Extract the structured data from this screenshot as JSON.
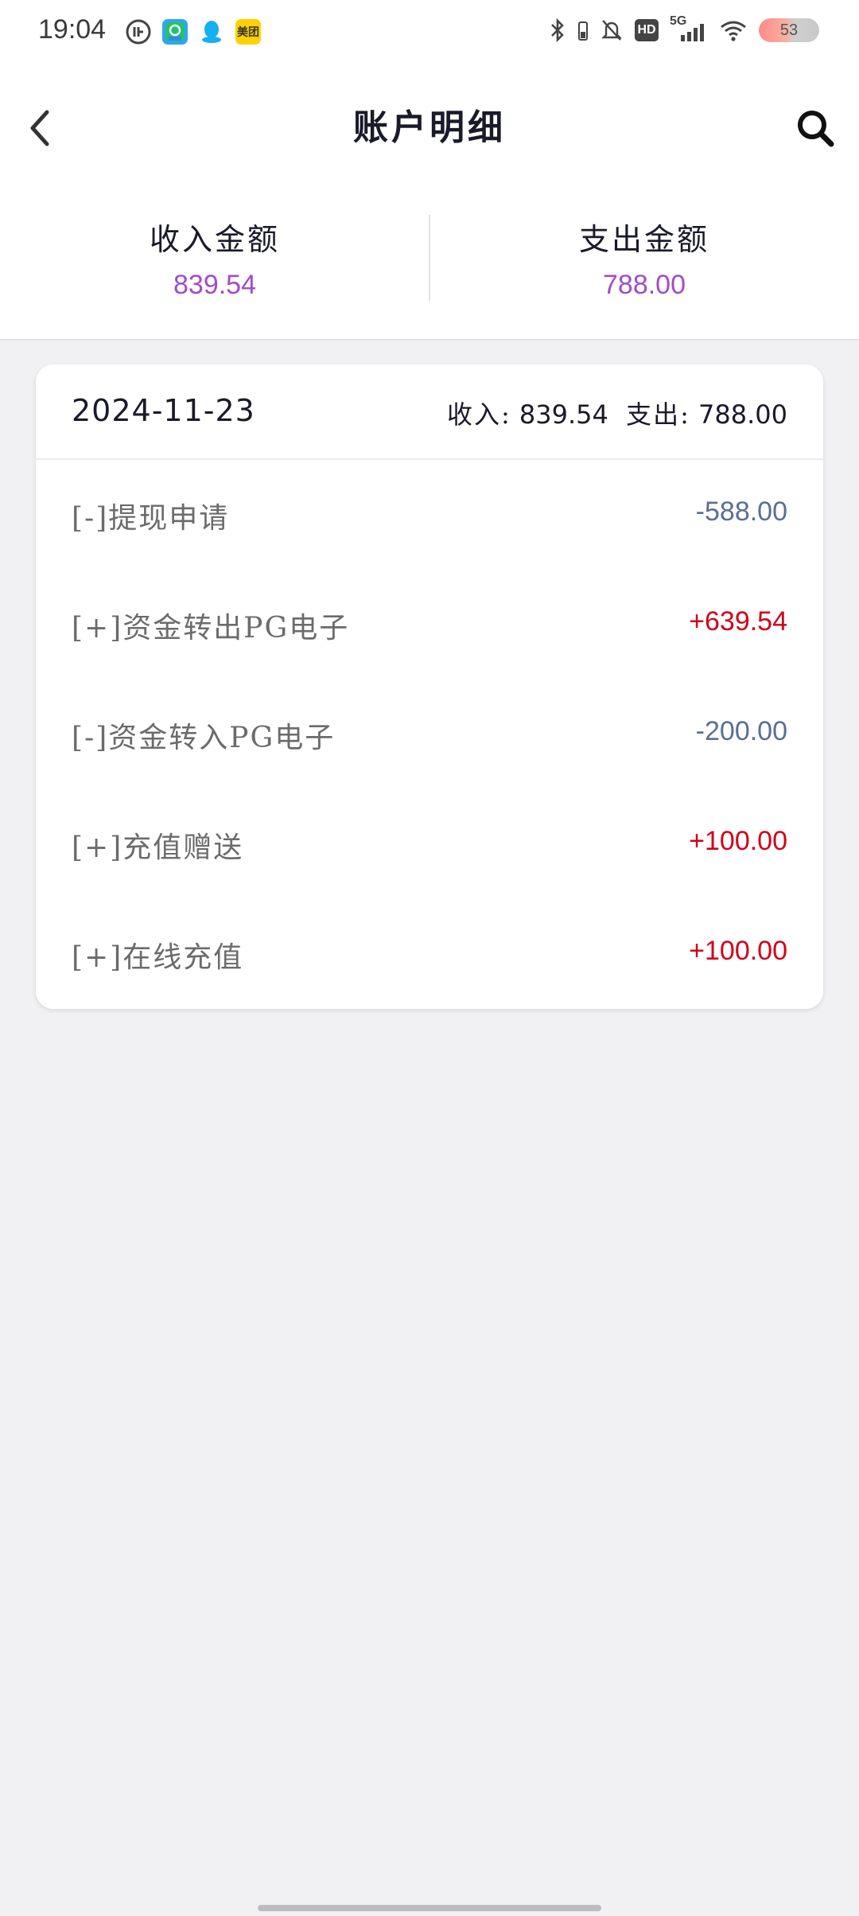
{
  "status_bar": {
    "time": "19:04",
    "battery": "53",
    "network": "5G",
    "hd": "HD",
    "meituan_label": "美团"
  },
  "header": {
    "title": "账户明细"
  },
  "summary": {
    "income_label": "收入金额",
    "income_value": "839.54",
    "expense_label": "支出金额",
    "expense_value": "788.00",
    "value_color": "#a24bc9"
  },
  "card": {
    "date": "2024-11-23",
    "income_label": "收入:",
    "income_total": "839.54",
    "expense_label": "支出:",
    "expense_total": "788.00",
    "rows": [
      {
        "label": "[-]提现申请",
        "amount": "-588.00",
        "sign": "neg"
      },
      {
        "label": "[+]资金转出PG电子",
        "amount": "+639.54",
        "sign": "pos"
      },
      {
        "label": "[-]资金转入PG电子",
        "amount": "-200.00",
        "sign": "neg"
      },
      {
        "label": "[+]充值赠送",
        "amount": "+100.00",
        "sign": "pos"
      },
      {
        "label": "[+]在线充值",
        "amount": "+100.00",
        "sign": "pos"
      }
    ]
  },
  "colors": {
    "positive": "#d0021b",
    "negative": "#5a6f93",
    "background": "#f1f1f3"
  },
  "icons": {
    "back": "chevron-left-icon",
    "search": "search-icon"
  }
}
